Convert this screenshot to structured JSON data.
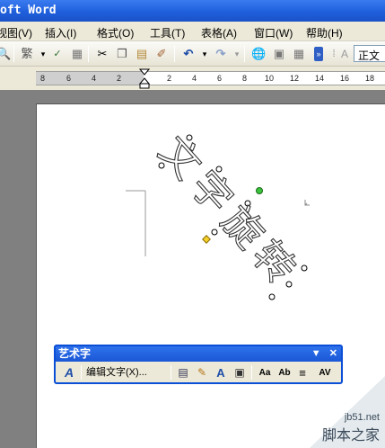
{
  "window": {
    "title": "oft Word"
  },
  "menu": [
    {
      "label": "视图(V)"
    },
    {
      "label": "插入(I)"
    },
    {
      "label": "格式(O)"
    },
    {
      "label": "工具(T)"
    },
    {
      "label": "表格(A)"
    },
    {
      "label": "窗口(W)"
    },
    {
      "label": "帮助(H)"
    }
  ],
  "toolbar": {
    "style_value": "正文",
    "icons": [
      "preview-icon",
      "chinese-convert-icon",
      "spellcheck-icon",
      "research-icon",
      "cut-icon",
      "copy-icon",
      "paste-icon",
      "format-painter-icon",
      "undo-icon",
      "redo-icon",
      "hyperlink-icon",
      "tables-icon",
      "insert-table-icon",
      "more-icon",
      "styles-icon"
    ]
  },
  "ruler": {
    "numbers": [
      "8",
      "6",
      "4",
      "2",
      "2",
      "4",
      "6",
      "8",
      "10",
      "12",
      "14",
      "16",
      "18"
    ]
  },
  "wordart": {
    "text": "文字旋转"
  },
  "wordart_toolbar": {
    "title": "艺术字",
    "edit_text_label": "编辑文字(X)...",
    "menu_glyph": "▼",
    "close_glyph": "✕",
    "icons": [
      "insert-wordart-icon",
      "wordart-gallery-icon",
      "format-wordart-icon",
      "wordart-shape-icon",
      "text-wrapping-icon",
      "same-letter-heights-icon",
      "vertical-text-icon",
      "alignment-icon",
      "character-spacing-icon"
    ]
  },
  "watermark": {
    "url": "jb51.net",
    "cn": "脚本之家"
  }
}
